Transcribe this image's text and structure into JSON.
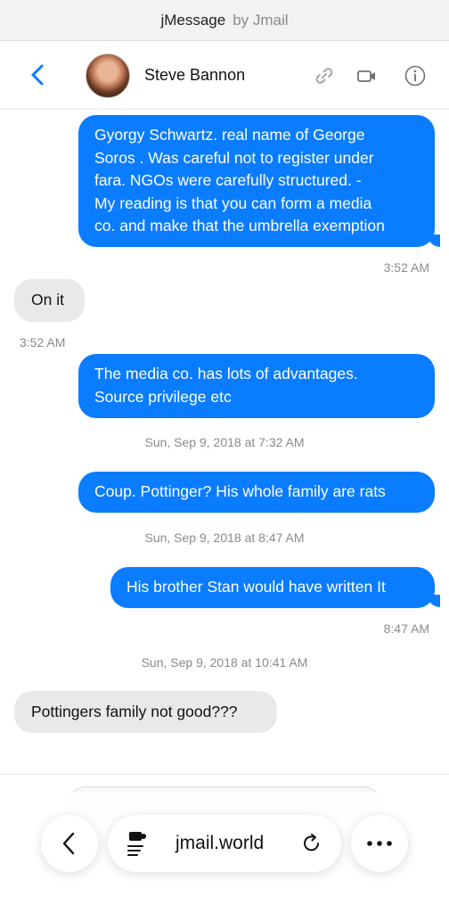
{
  "topbar": {
    "brand": "jMessage",
    "by": "by Jmail"
  },
  "header": {
    "contact_name": "Steve Bannon",
    "icons": [
      "back-chevron-icon",
      "link-icon",
      "video-camera-icon",
      "info-icon"
    ]
  },
  "messages": [
    {
      "direction": "outgoing",
      "lines": [
        "Gyorgy Schwartz. real name of George",
        "Soros . Was careful not to register under",
        "fara. NGOs were carefully structured. -",
        "My reading is that you can form a media",
        "co. and make that the umbrella exemption"
      ]
    },
    {
      "direction": "incoming",
      "text": "On it"
    },
    {
      "direction": "outgoing",
      "lines": [
        "The media co. has lots of advantages.",
        "Source privilege etc"
      ]
    },
    {
      "direction": "outgoing",
      "text": "Coup. Pottinger? His whole family are rats"
    },
    {
      "direction": "outgoing",
      "text": "His brother Stan would have written It"
    },
    {
      "direction": "incoming",
      "text": "Pottingers family not good???"
    }
  ],
  "timestamps": {
    "t1": "3:52 AM",
    "t2": "3:52 AM",
    "t3": "Sun, Sep 9, 2018 at 7:32 AM",
    "t4": "Sun, Sep 9, 2018 at 8:47 AM",
    "t5": "8:47 AM",
    "t6": "Sun, Sep 9, 2018 at 10:41 AM"
  },
  "browser": {
    "url": "jmail.world",
    "icons": [
      "browser-back-icon",
      "page-settings-icon",
      "reload-icon",
      "more-icon"
    ]
  },
  "colors": {
    "outgoing": "#0a7cff",
    "incoming": "#e9e9eb",
    "accent": "#0a7cff"
  }
}
